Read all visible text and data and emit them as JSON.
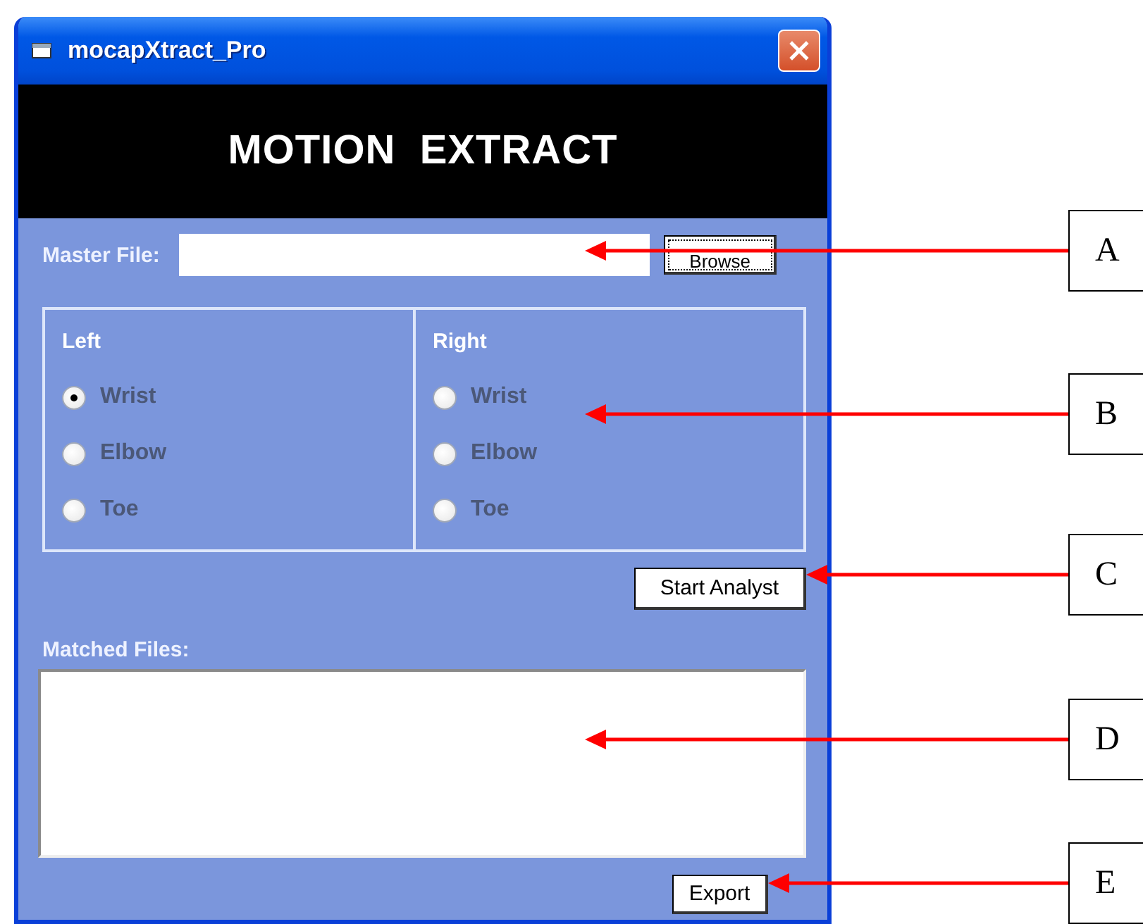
{
  "window": {
    "title": "mocapXtract_Pro"
  },
  "banner": {
    "text": "MOTION  EXTRACT"
  },
  "master_file": {
    "label": "Master File:",
    "browse_button": "Browse"
  },
  "groups": [
    {
      "title": "Left",
      "options": [
        {
          "label": "Wrist",
          "selected": true
        },
        {
          "label": "Elbow",
          "selected": false
        },
        {
          "label": "Toe",
          "selected": false
        }
      ]
    },
    {
      "title": "Right",
      "options": [
        {
          "label": "Wrist",
          "selected": false
        },
        {
          "label": "Elbow",
          "selected": false
        },
        {
          "label": "Toe",
          "selected": false
        }
      ]
    }
  ],
  "start_button": "Start Analyst",
  "matched_files": {
    "label": "Matched Files:"
  },
  "export_button": "Export",
  "callouts": [
    {
      "letter": "A"
    },
    {
      "letter": "B"
    },
    {
      "letter": "C"
    },
    {
      "letter": "D"
    },
    {
      "letter": "E"
    }
  ]
}
